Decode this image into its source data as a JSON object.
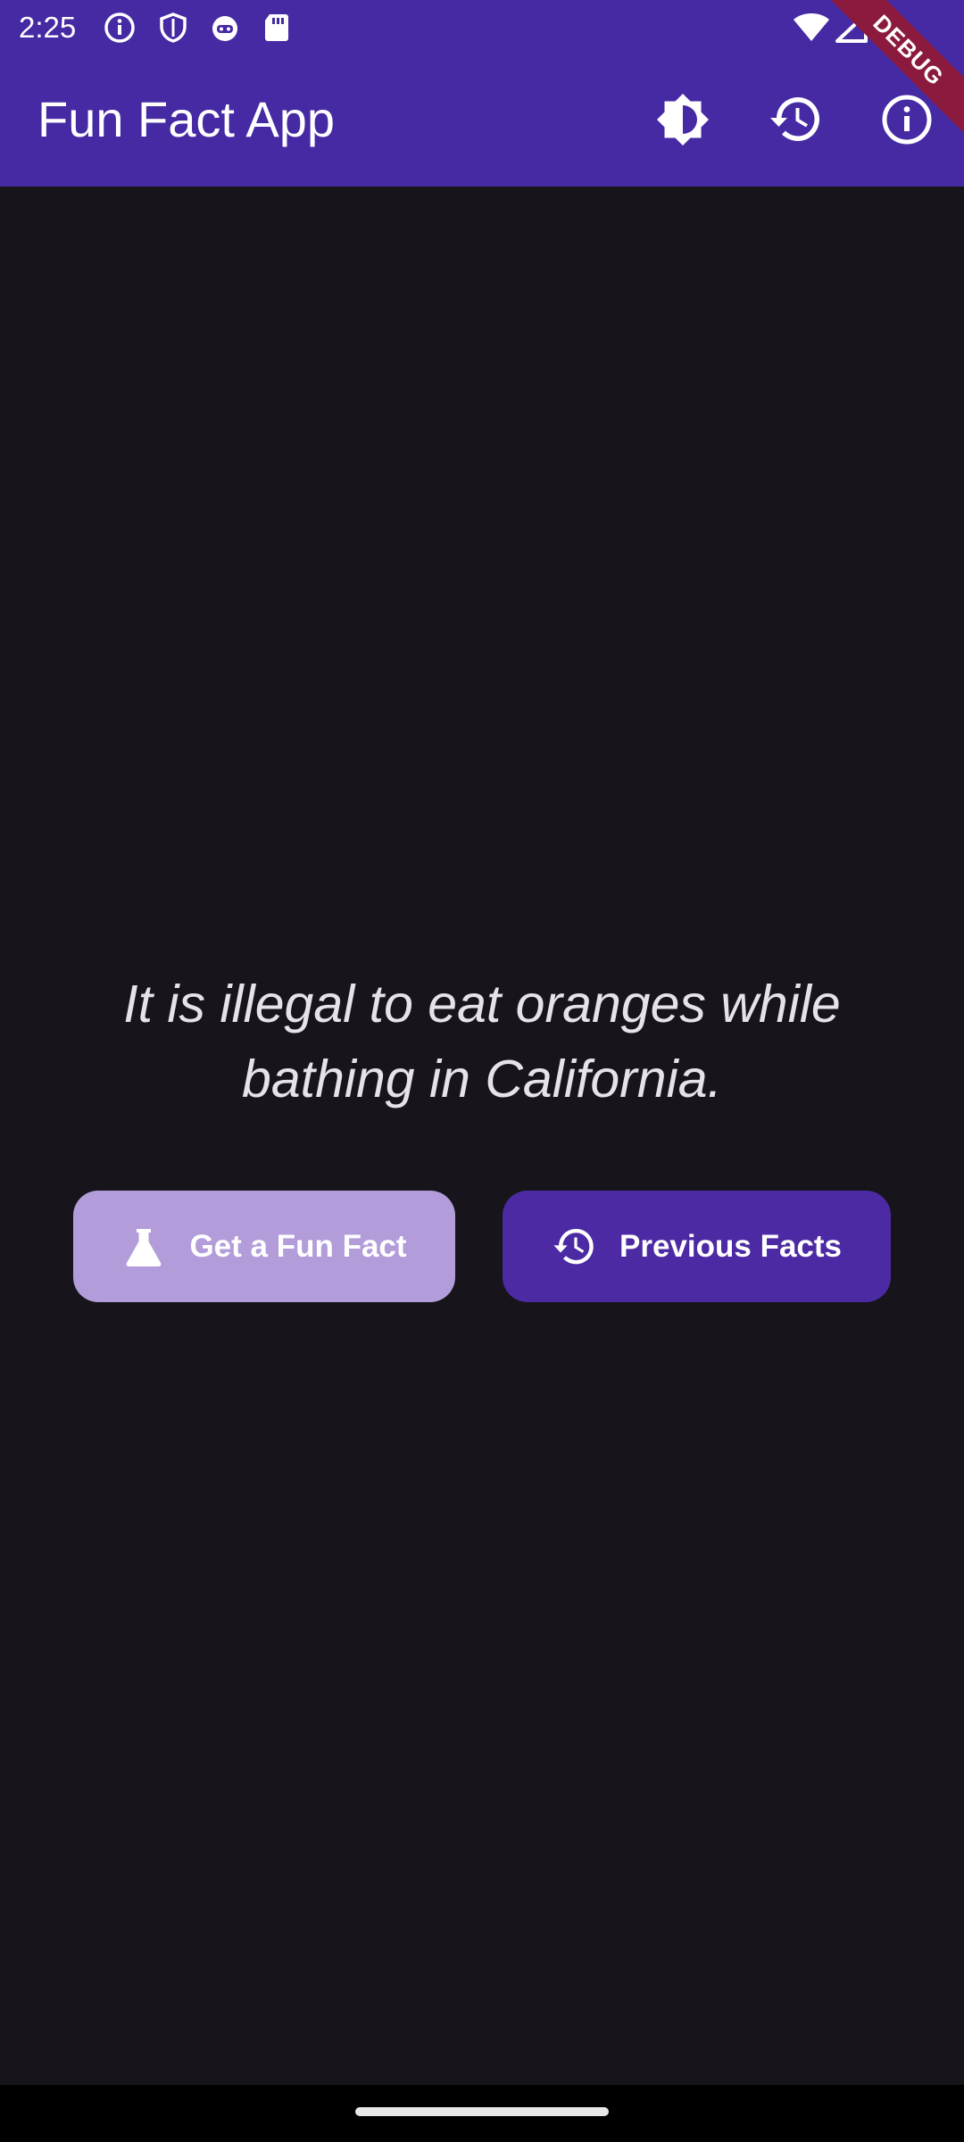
{
  "status_bar": {
    "time": "2:25",
    "left_icons": [
      "info-icon",
      "shield-icon",
      "robot-icon",
      "sd-card-icon"
    ],
    "right_icons": [
      "wifi-icon",
      "signal-icon"
    ]
  },
  "app_bar": {
    "title": "Fun Fact App",
    "actions": [
      {
        "name": "theme-toggle-button",
        "icon": "brightness-icon"
      },
      {
        "name": "history-button",
        "icon": "history-icon"
      },
      {
        "name": "info-button",
        "icon": "info-icon"
      }
    ],
    "debug_banner": "DEBUG"
  },
  "content": {
    "fact": "It is illegal to eat oranges while bathing in California.",
    "buttons": {
      "get_fact": {
        "label": "Get a Fun Fact",
        "icon": "flask-icon"
      },
      "previous_facts": {
        "label": "Previous Facts",
        "icon": "history-icon"
      }
    }
  },
  "colors": {
    "app_bar": "#452aa3",
    "background": "#17151b",
    "primary_button": "#4c2aa3",
    "secondary_button": "#b29dda",
    "debug_ribbon": "#8b1a3c"
  }
}
